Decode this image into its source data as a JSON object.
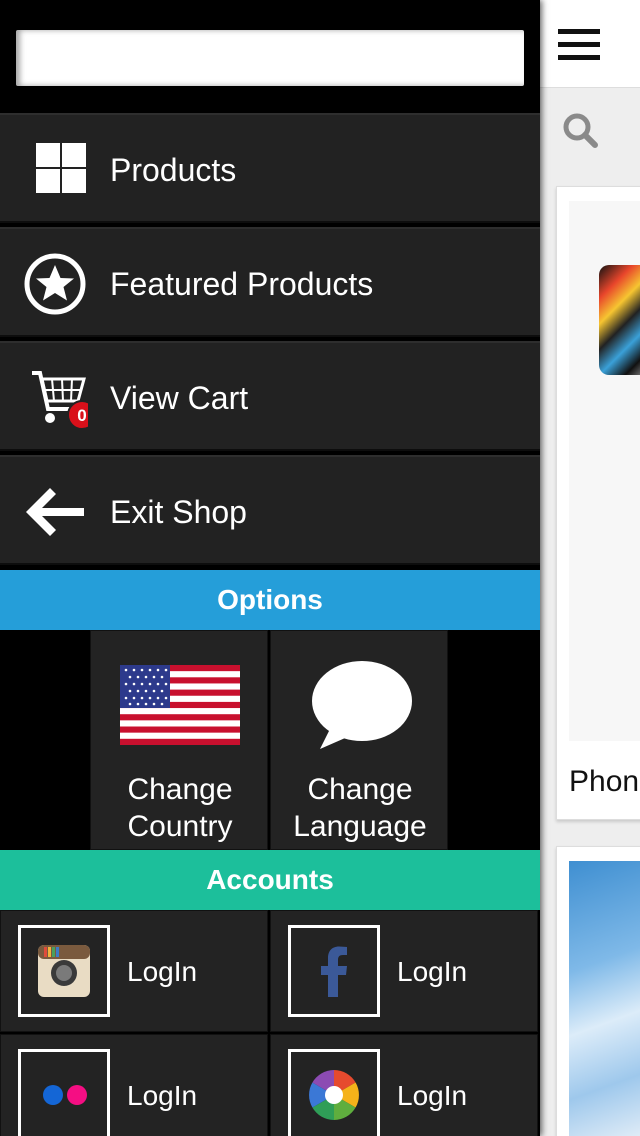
{
  "search": {
    "placeholder": ""
  },
  "menu": {
    "items": [
      {
        "label": "Products",
        "icon": "grid-icon"
      },
      {
        "label": "Featured Products",
        "icon": "star-icon"
      },
      {
        "label": "View Cart",
        "icon": "cart-icon",
        "badge": "0"
      },
      {
        "label": "Exit Shop",
        "icon": "arrow-left-icon"
      }
    ]
  },
  "options": {
    "title": "Options",
    "tiles": [
      {
        "line1": "Change",
        "line2": "Country",
        "icon": "us-flag-icon"
      },
      {
        "line1": "Change",
        "line2": "Language",
        "icon": "speech-bubble-icon"
      }
    ]
  },
  "accounts": {
    "title": "Accounts",
    "items": [
      {
        "label": "LogIn",
        "icon": "instagram-icon"
      },
      {
        "label": "LogIn",
        "icon": "facebook-icon"
      },
      {
        "label": "LogIn",
        "icon": "flickr-icon"
      },
      {
        "label": "LogIn",
        "icon": "picasa-icon"
      }
    ]
  },
  "content": {
    "product_name": "Phon"
  },
  "colors": {
    "options_bar": "#259ed9",
    "accounts_bar": "#1cbf9b",
    "badge": "#d9101a"
  }
}
